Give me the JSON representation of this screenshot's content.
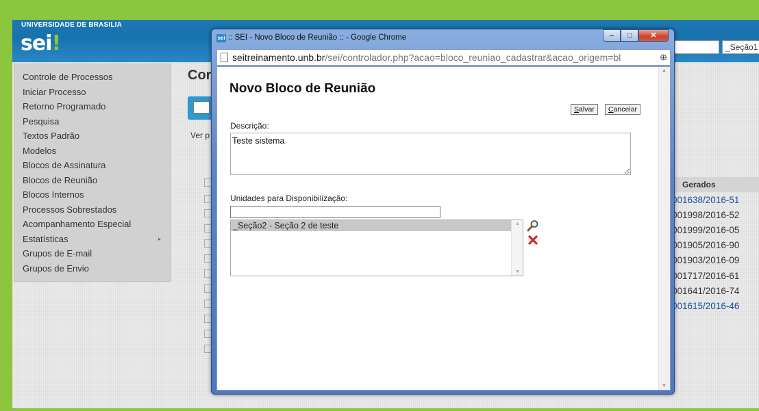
{
  "app": {
    "university": "UNIVERSIDADE DE BRASILIA",
    "logo_text": "sei",
    "logo_bang": "!",
    "unit_selector": "_Seção1 ▾"
  },
  "sidebar": {
    "items": [
      {
        "label": "Controle de Processos"
      },
      {
        "label": "Iniciar Processo"
      },
      {
        "label": "Retorno Programado"
      },
      {
        "label": "Pesquisa"
      },
      {
        "label": "Textos Padrão"
      },
      {
        "label": "Modelos"
      },
      {
        "label": "Blocos de Assinatura"
      },
      {
        "label": "Blocos de Reunião"
      },
      {
        "label": "Blocos Internos"
      },
      {
        "label": "Processos Sobrestados"
      },
      {
        "label": "Acompanhamento Especial"
      },
      {
        "label": "Estatísticas",
        "submenu_arrow": "▸"
      },
      {
        "label": "Grupos de E-mail"
      },
      {
        "label": "Grupos de Envio"
      }
    ]
  },
  "main": {
    "title_partial": "Cor",
    "ver_text": "Ver p",
    "gerados_header": "Gerados",
    "process_numbers": [
      {
        "text": "001638/2016-51",
        "link": true
      },
      {
        "text": "001998/2016-52",
        "link": false
      },
      {
        "text": "001999/2016-05",
        "link": false
      },
      {
        "text": "001905/2016-90",
        "link": false
      },
      {
        "text": "001903/2016-09",
        "link": false
      },
      {
        "text": "001717/2016-61",
        "link": false
      },
      {
        "text": "001641/2016-74",
        "link": false
      },
      {
        "text": "001615/2016-46",
        "link": true
      }
    ]
  },
  "popup": {
    "favicon": "sei",
    "window_title": ":: SEI - Novo Bloco de Reunião :: - Google Chrome",
    "url_host": "seitreinamento.unb.br",
    "url_path": "/sei/controlador.php?acao=bloco_reuniao_cadastrar&acao_origem=bl",
    "window_buttons": {
      "minimize": "–",
      "maximize": "□",
      "close": "✕"
    },
    "form": {
      "title": "Novo Bloco de Reunião",
      "save_label": "Salvar",
      "cancel_label": "Cancelar",
      "description_label": "Descrição:",
      "description_value": "Teste sistema",
      "units_label": "Unidades para Disponibilização:",
      "unit_input_value": "",
      "units": [
        "_Seção2 - Seção 2 de teste"
      ]
    }
  },
  "colors": {
    "outer_border": "#8cc63f",
    "header_blue": "#1772ac",
    "link_blue": "#1a4fa0",
    "remove_red": "#d9261c"
  },
  "icons": {
    "search_units": "magnifier-icon",
    "remove_unit": "red-x-icon",
    "page_zoom": "zoom-icon",
    "page_document": "document-icon"
  }
}
